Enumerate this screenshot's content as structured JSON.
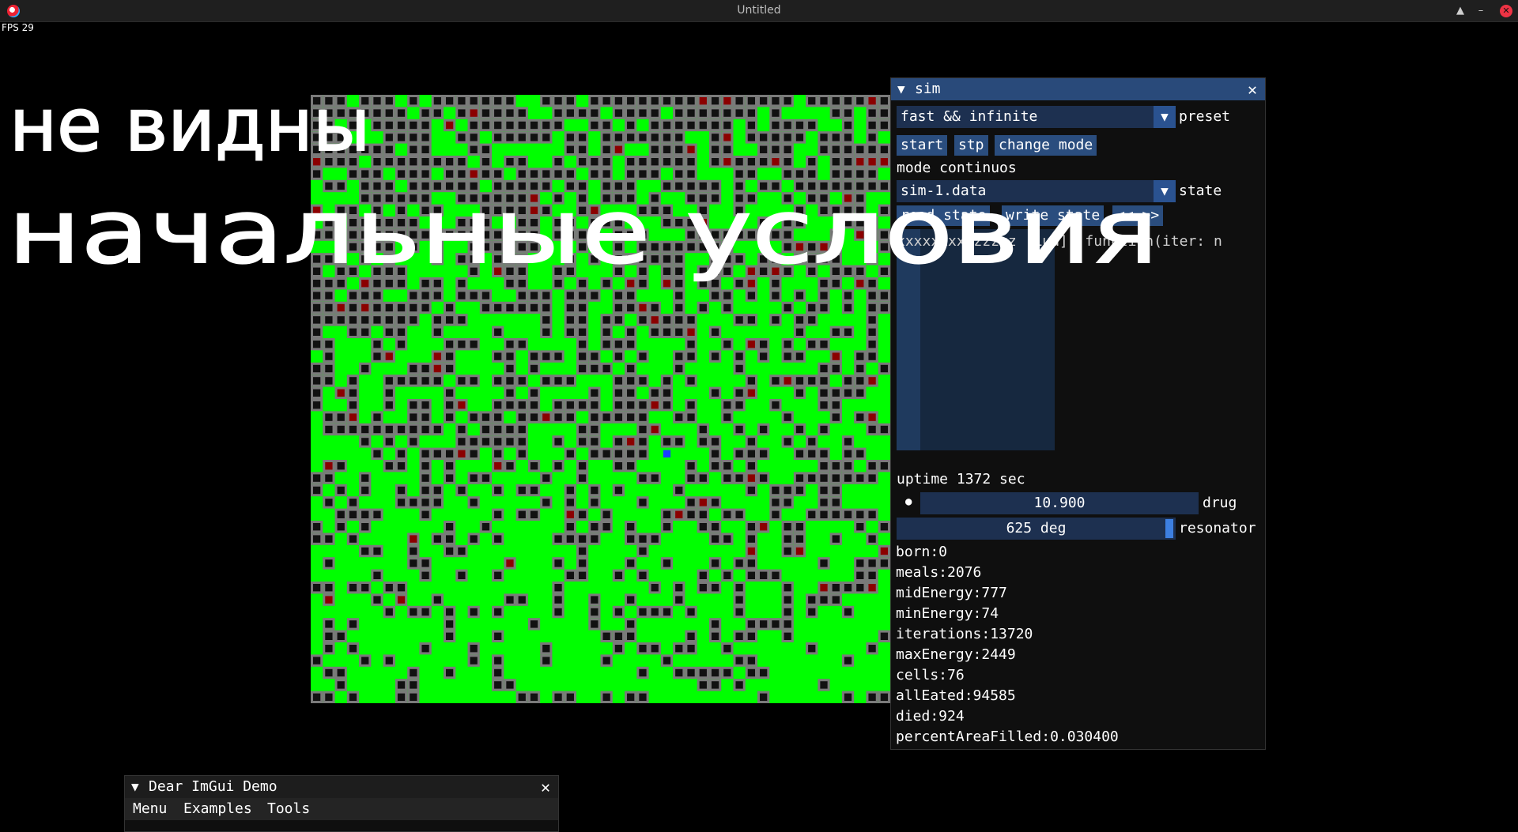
{
  "window": {
    "title": "Untitled",
    "fps": "FPS 29"
  },
  "sim": {
    "title": "sim",
    "preset_value": "fast && infinite",
    "preset_label": "preset",
    "btn_start": "start",
    "btn_stp": "stp",
    "btn_change_mode": "change mode",
    "mode_text": "mode continuos",
    "state_value": "sim-1.data",
    "state_label": "state",
    "btn_read_state": "read state",
    "btn_write_state": "write state",
    "btn_arrows": "<< >>",
    "lua_text": "xxxxxxxxzzzzzz  [Lua]: function(iter: n",
    "uptime": "uptime 1372 sec",
    "drug_value": "10.900",
    "drug_label": "drug",
    "resonator_value": "625 deg",
    "resonator_label": "resonator",
    "stats": [
      "born:0",
      "meals:2076",
      "midEnergy:777",
      "minEnergy:74",
      "iterations:13720",
      "maxEnergy:2449",
      "cells:76",
      "allEated:94585",
      "died:924",
      "percentAreaFilled:0.030400"
    ]
  },
  "demo": {
    "title": "Dear ImGui Demo",
    "menu": [
      "Menu",
      "Examples",
      "Tools"
    ]
  },
  "handwriting": {
    "line1": "не видны",
    "line2": "начальные условия"
  },
  "colors": {
    "grid_green": "#00ff00",
    "grid_gray": "#7a7a7a",
    "grid_black": "#111111",
    "cell_red": "#8b0000",
    "cell_blue": "#1a3cff",
    "imgui_title": "#294a7a",
    "imgui_button": "#2a4d7e",
    "imgui_frame": "#1d3050"
  }
}
